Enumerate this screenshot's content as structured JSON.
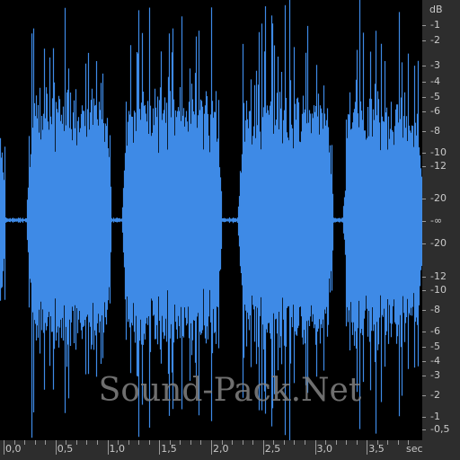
{
  "colors": {
    "background": "#000000",
    "waveform": "#3e8ae6",
    "ruler_bg": "#2d2d2d",
    "ruler_text": "#c9c9c9"
  },
  "watermark": "Sound-Pack.Net",
  "db_ruler": {
    "unit": "dB",
    "labels": [
      "-1",
      "-2",
      "-3",
      "-4",
      "-5",
      "-6",
      "-8",
      "-10",
      "-12",
      "-20",
      "-∞",
      "-20",
      "-12",
      "-10",
      "-8",
      "-6",
      "-5",
      "-4",
      "-3",
      "-2",
      "-1",
      "-0,5"
    ]
  },
  "time_ruler": {
    "unit": "sec",
    "labels": [
      "0,0",
      "0,5",
      "1,0",
      "1,5",
      "2,0",
      "2,5",
      "3,0",
      "3,5"
    ],
    "values": [
      0,
      0.5,
      1.0,
      1.5,
      2.0,
      2.5,
      3.0,
      3.5
    ],
    "duration": 4.0
  },
  "waveform": {
    "channels": 1,
    "bursts": [
      {
        "start": 0.25,
        "end": 1.05
      },
      {
        "start": 1.15,
        "end": 2.1
      },
      {
        "start": 2.25,
        "end": 3.15
      },
      {
        "start": 3.25,
        "end": 4.0
      }
    ]
  }
}
